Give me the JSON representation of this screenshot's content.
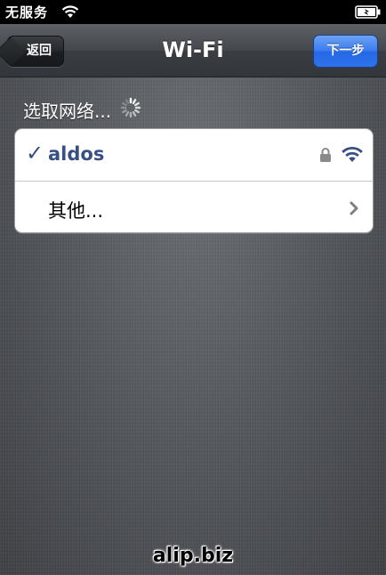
{
  "status_bar": {
    "carrier": "无服务",
    "wifi_icon": "wifi-icon",
    "battery_icon": "battery-charging-icon"
  },
  "nav_bar": {
    "back_label": "返回",
    "title": "Wi-Fi",
    "next_label": "下一步",
    "next_color": "#2f72ea"
  },
  "section": {
    "header": "选取网络...",
    "spinner_icon": "activity-spinner-icon"
  },
  "networks": [
    {
      "name": "aldos",
      "selected": true,
      "secured": true,
      "signal": "full",
      "accent": "#384f83"
    }
  ],
  "other": {
    "label": "其他..."
  },
  "watermark": "alip.biz"
}
